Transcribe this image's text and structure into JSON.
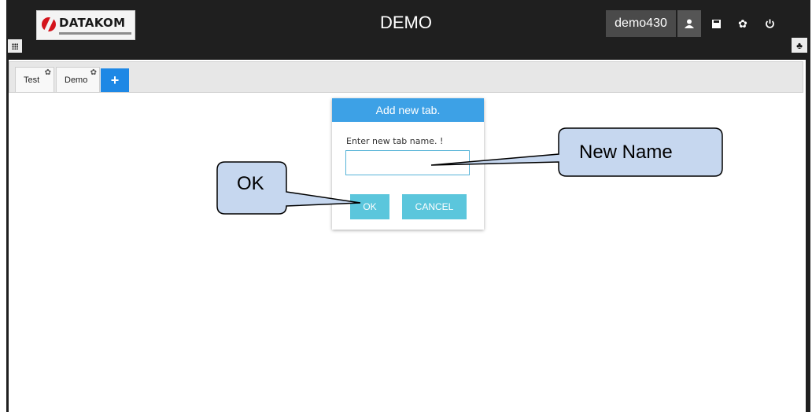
{
  "header": {
    "logo_text": "DATAKOM",
    "app_title": "DEMO",
    "username": "demo430",
    "icons": [
      "user-icon",
      "save-icon",
      "gear-icon",
      "power-icon",
      "grid-icon",
      "tree-icon"
    ]
  },
  "tabs": [
    {
      "label": "Test"
    },
    {
      "label": "Demo"
    }
  ],
  "add_tab_symbol": "+",
  "dialog": {
    "title": "Add new tab.",
    "prompt": "Enter new tab name. !",
    "input_value": "",
    "ok_label": "OK",
    "cancel_label": "CANCEL"
  },
  "annotations": {
    "new_name": "New Name",
    "ok": "OK"
  },
  "colors": {
    "topbar": "#1f1f1f",
    "accent_blue": "#1e88e5",
    "dialog_header": "#3da1e6",
    "button_teal": "#5bc6dc",
    "callout_fill": "#c6d7ef"
  }
}
